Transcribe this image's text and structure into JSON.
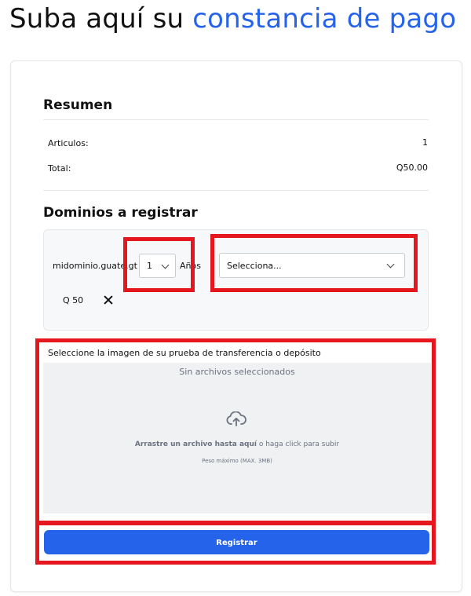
{
  "page": {
    "heading_prefix": "Suba aquí su ",
    "heading_accent": "constancia de pago",
    "accent_color": "#2563eb",
    "highlight_color": "#e5161d"
  },
  "summary": {
    "title": "Resumen",
    "rows": [
      {
        "label": "Articulos:",
        "value": "1"
      },
      {
        "label": "Total:",
        "value": "Q50.00"
      }
    ]
  },
  "domains": {
    "title": "Dominios a registrar",
    "items": [
      {
        "name": "midominio.guate.gt",
        "years_value": "1",
        "years_label": "Años",
        "type_select_value": "Selecciona...",
        "price": "Q 50",
        "remove_icon": "close-icon"
      }
    ]
  },
  "upload": {
    "label": "Seleccione la imagen de su prueba de transferencia o depósito",
    "no_files": "Sin archivos seleccionados",
    "icon": "cloud-upload-icon",
    "drag_bold": "Arrastre un archivo hasta aquí",
    "drag_mid": " o haga ",
    "drag_click": "click",
    "drag_end": " para subir",
    "max_size": "Peso máximo (MAX. 3MB)"
  },
  "submit_label": "Registrar"
}
